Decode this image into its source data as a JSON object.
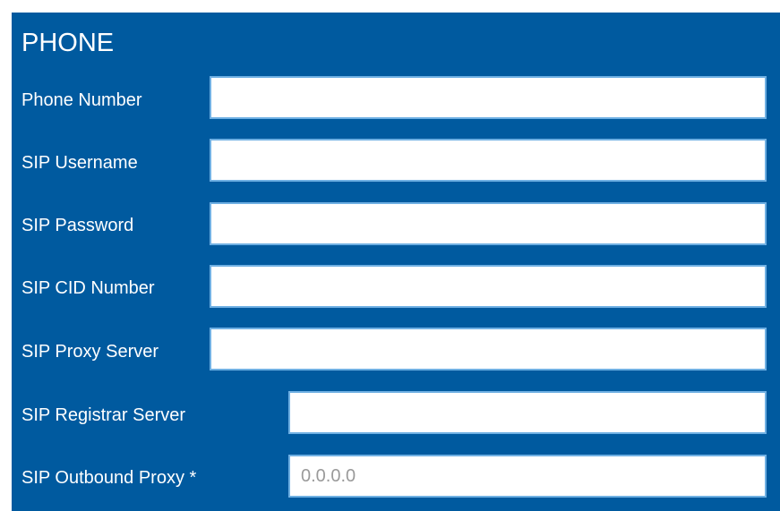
{
  "section": {
    "title": "PHONE"
  },
  "fields": [
    {
      "label": "Phone Number",
      "value": "",
      "placeholder": ""
    },
    {
      "label": "SIP Username",
      "value": "",
      "placeholder": ""
    },
    {
      "label": "SIP Password",
      "value": "",
      "placeholder": ""
    },
    {
      "label": "SIP CID Number",
      "value": "",
      "placeholder": ""
    },
    {
      "label": "SIP Proxy Server",
      "value": "",
      "placeholder": ""
    },
    {
      "label": "SIP Registrar Server",
      "value": "",
      "placeholder": ""
    },
    {
      "label": "SIP Outbound Proxy *",
      "value": "",
      "placeholder": "0.0.0.0"
    }
  ],
  "colors": {
    "panel_background": "#005a9f",
    "field_border": "#6fb0e3",
    "text": "#ffffff"
  }
}
